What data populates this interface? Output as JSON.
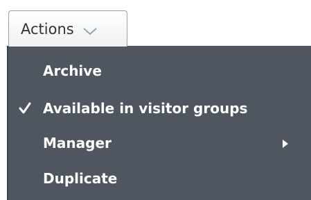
{
  "toolbar": {
    "actions_label": "Actions"
  },
  "menu": {
    "items": [
      {
        "label": "Archive",
        "checked": false,
        "has_submenu": false
      },
      {
        "label": "Available in visitor groups",
        "checked": true,
        "has_submenu": false
      },
      {
        "label": "Manager",
        "checked": false,
        "has_submenu": true
      },
      {
        "label": "Duplicate",
        "checked": false,
        "has_submenu": false
      }
    ]
  },
  "icons": {
    "dropdown": "chevron-down-icon",
    "check": "checkmark-icon",
    "submenu": "caret-right-icon"
  },
  "colors": {
    "menu_background": "#505660",
    "menu_text": "#ffffff",
    "button_text": "#333333"
  }
}
